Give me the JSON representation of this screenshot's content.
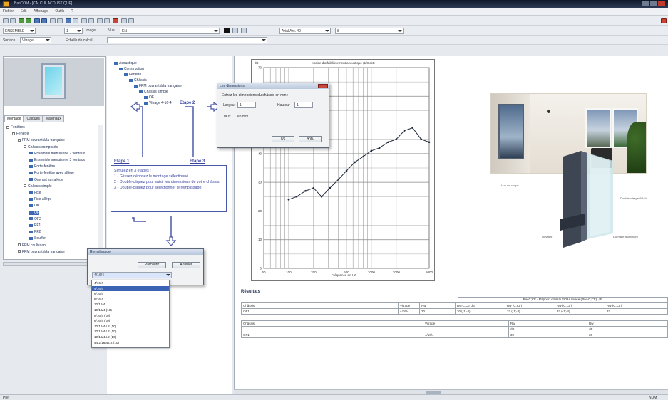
{
  "window": {
    "title": "BatiCOM - [CALCUL ACOUSTIQUE]"
  },
  "menu": {
    "items": [
      "Fichier",
      "Edit",
      "Affichage",
      "Outils",
      "?"
    ]
  },
  "toolbar2": {
    "combo1": "ENSEMBLE",
    "combo2": "1",
    "image_label": "Image",
    "view_label": "Vue",
    "view_combo": "EN",
    "font_combo": "Arial Arc. 40",
    "size_combo": "8"
  },
  "toolbar3": {
    "label1": "Surface",
    "combo1": "Vitrage",
    "label2": "Echelle de calcul",
    "combo2": ""
  },
  "left_panel": {
    "tabs": [
      "Montage",
      "Calques",
      "Matériaux"
    ],
    "tree": [
      {
        "label": "Fenêtres",
        "indent": 0,
        "type": "folder"
      },
      {
        "label": "Fenêtre",
        "indent": 1,
        "type": "folder"
      },
      {
        "label": "FPM ouvrant à la française",
        "indent": 2,
        "type": "folder"
      },
      {
        "label": "Châssis composés",
        "indent": 3,
        "type": "folder"
      },
      {
        "label": "Ensemble menuiserie 2 ventaux",
        "indent": 4,
        "type": "item"
      },
      {
        "label": "Ensemble menuiserie 3 ventaux",
        "indent": 4,
        "type": "item"
      },
      {
        "label": "Porte-fenêtre",
        "indent": 4,
        "type": "item"
      },
      {
        "label": "Porte-fenêtre avec allège",
        "indent": 4,
        "type": "item"
      },
      {
        "label": "Ouvrant sur allège",
        "indent": 4,
        "type": "item"
      },
      {
        "label": "Châssis simple",
        "indent": 3,
        "type": "folder"
      },
      {
        "label": "Fixe",
        "indent": 4,
        "type": "item"
      },
      {
        "label": "Fixe allège",
        "indent": 4,
        "type": "item"
      },
      {
        "label": "OB",
        "indent": 4,
        "type": "item"
      },
      {
        "label": "OF",
        "indent": 4,
        "type": "item",
        "selected": true
      },
      {
        "label": "OF2",
        "indent": 4,
        "type": "item"
      },
      {
        "label": "PF1",
        "indent": 4,
        "type": "item"
      },
      {
        "label": "PF2",
        "indent": 4,
        "type": "item"
      },
      {
        "label": "Soufflet",
        "indent": 4,
        "type": "item"
      },
      {
        "label": "FPM coulissant",
        "indent": 2,
        "type": "folder"
      },
      {
        "label": "FPM ouvrant à la française",
        "indent": 2,
        "type": "folder"
      }
    ]
  },
  "middle_tree": [
    {
      "label": "Acoustique",
      "indent": 0
    },
    {
      "label": "Construction",
      "indent": 1
    },
    {
      "label": "Fenêtre",
      "indent": 2
    },
    {
      "label": "Châssis",
      "indent": 3
    },
    {
      "label": "FPM ouvrant à la française",
      "indent": 4
    },
    {
      "label": "Châssis simple",
      "indent": 5
    },
    {
      "label": "OF",
      "indent": 6
    },
    {
      "label": "Vitrage 4-16-4",
      "indent": 6
    }
  ],
  "steps": {
    "etape1": "Etape 1",
    "etape2": "Etape 2",
    "etape3": "Etape 3"
  },
  "instructions": [
    "Simulez en 3 étapes :",
    "1 - Glissez/déposez le montage sélectionné.",
    "2 - Double-cliquez pour saisir les dimensions de votre châssis.",
    "3 - Double-cliquez pour sélectionner le remplissage."
  ],
  "dim_dialog": {
    "title": "Les dimensions",
    "prompt": "Entrez les dimensions du châssis en mm :",
    "field1_label": "Largeur",
    "field1_value": "1",
    "field2_label": "Hauteur",
    "field2_value": "1",
    "hint_label": "Taux",
    "hint_value": "en mm",
    "ok": "Ok",
    "cancel": "Ann."
  },
  "fill_dialog": {
    "title": "Remplissage",
    "btn1": "Parcourir",
    "btn2": "Annuler",
    "current": "4/16/4",
    "options": [
      "4/16/4",
      "4/16/4",
      "6/16/4",
      "8/16/4",
      "10/16/4",
      "10/16/4 (10)",
      "8/16/4 (10)",
      "6/16/4 (10)",
      "10/16/44.2 (10)",
      "10/16/44.2 (10)",
      "10/16/44.2 (10)",
      "44.2/16/44.2 (10)"
    ],
    "selected_index": 1
  },
  "chart_data": {
    "type": "line",
    "title": "Indice d'affaiblissement acoustique (1/3 oct)",
    "xlabel": "Fréquence en Hz",
    "ylabel": "dB",
    "x": [
      100,
      125,
      160,
      200,
      250,
      315,
      400,
      500,
      630,
      800,
      1000,
      1250,
      1600,
      2000,
      2500,
      3150,
      4000,
      5000
    ],
    "values": [
      24,
      25,
      27,
      28,
      25,
      28,
      31,
      34,
      37,
      39,
      41,
      42,
      44,
      45,
      48,
      49,
      45,
      44
    ],
    "ylim": [
      0,
      70
    ],
    "xticks": [
      "50",
      "100",
      "200",
      "500",
      "1000",
      "2000",
      "5000"
    ],
    "yticks": [
      "0",
      "10",
      "20",
      "30",
      "40",
      "50",
      "60",
      "70"
    ],
    "grid": true,
    "color": "#1e2a3c"
  },
  "results": {
    "heading": "Résultats",
    "group_header": "Rw,C;Ctr - Rapport d'essai FCBA Indice (Rw+C;Ctr), dB",
    "table1_header": [
      "Châssis",
      "Vitrage",
      "Rw",
      "Rw,C;Ctr dB",
      "Rw (C;Ctr)",
      "Rw (C;Ctr)",
      "Rw (C;Ctr)"
    ],
    "table1_row": [
      "OF1",
      "4/16/4",
      "30",
      "30 (-1;-4)",
      "32 (-1;-3)",
      "32 (-1;-4)",
      "32"
    ],
    "table2_header": [
      "Châssis",
      "Vitrage",
      "Rw",
      "Rw"
    ],
    "table2_units": [
      "",
      "",
      "dB",
      "dB"
    ],
    "table2_row": [
      "OF1",
      "4/16/4",
      "30",
      "30"
    ]
  },
  "annotations": {
    "a1": "Vue en coupe",
    "a2": "Double vitrage 4/16/4",
    "a3": "Ouvrant",
    "a4": "Dormant aluminium"
  },
  "statusbar": {
    "left": "Prêt",
    "right": "NUM"
  },
  "colors": {
    "accent": "#4a58a8",
    "title_bar": "#1c2740"
  }
}
